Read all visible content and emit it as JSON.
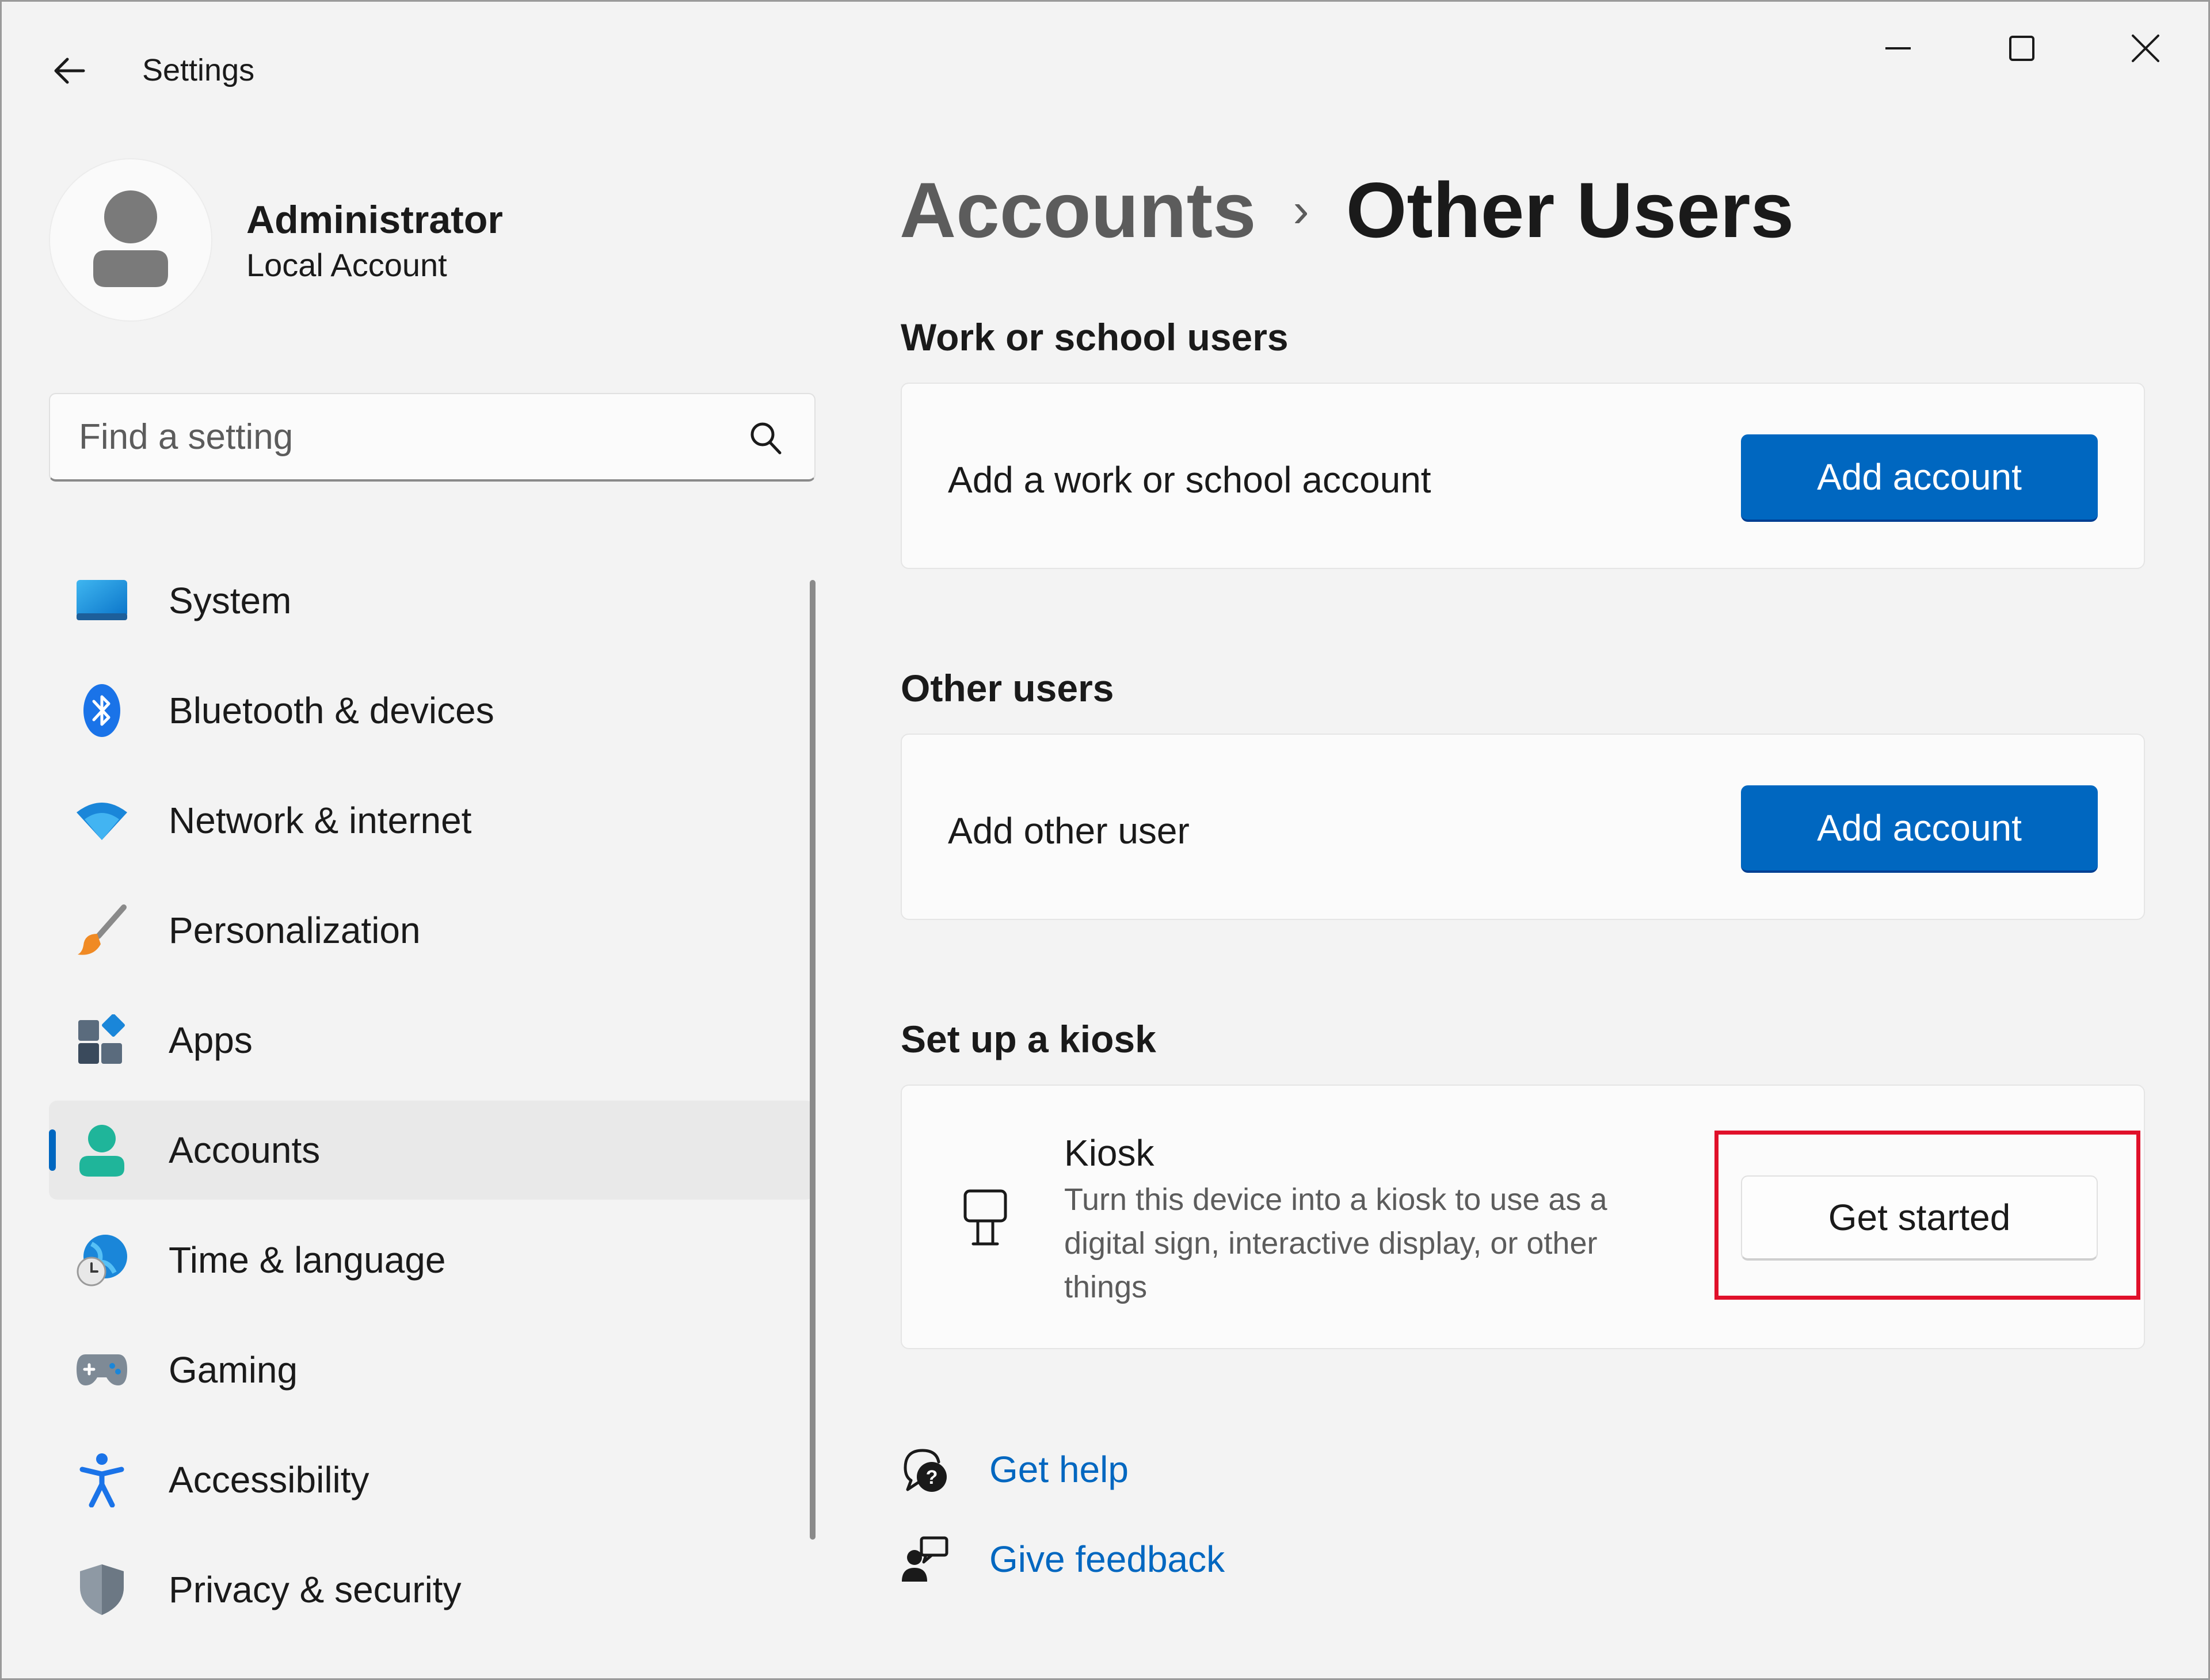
{
  "window": {
    "title": "Settings"
  },
  "profile": {
    "name": "Administrator",
    "account_type": "Local Account"
  },
  "search": {
    "placeholder": "Find a setting"
  },
  "nav": {
    "items": [
      {
        "label": "System",
        "icon": "system-icon"
      },
      {
        "label": "Bluetooth & devices",
        "icon": "bluetooth-icon"
      },
      {
        "label": "Network & internet",
        "icon": "wifi-icon"
      },
      {
        "label": "Personalization",
        "icon": "brush-icon"
      },
      {
        "label": "Apps",
        "icon": "apps-icon"
      },
      {
        "label": "Accounts",
        "icon": "accounts-icon",
        "active": true
      },
      {
        "label": "Time & language",
        "icon": "globe-clock-icon"
      },
      {
        "label": "Gaming",
        "icon": "gamepad-icon"
      },
      {
        "label": "Accessibility",
        "icon": "accessibility-icon"
      },
      {
        "label": "Privacy & security",
        "icon": "shield-icon"
      }
    ]
  },
  "breadcrumb": {
    "parent": "Accounts",
    "separator": "›",
    "current": "Other Users"
  },
  "sections": {
    "work": {
      "title": "Work or school users",
      "label": "Add a work or school account",
      "button": "Add account"
    },
    "other": {
      "title": "Other users",
      "label": "Add other user",
      "button": "Add account"
    },
    "kiosk": {
      "title": "Set up a kiosk",
      "item_title": "Kiosk",
      "description": "Turn this device into a kiosk to use as a digital sign, interactive display, or other things",
      "button": "Get started"
    }
  },
  "links": {
    "help": "Get help",
    "feedback": "Give feedback"
  },
  "colors": {
    "accent": "#0067c0",
    "highlight": "#e0102a",
    "background": "#f3f3f3"
  }
}
